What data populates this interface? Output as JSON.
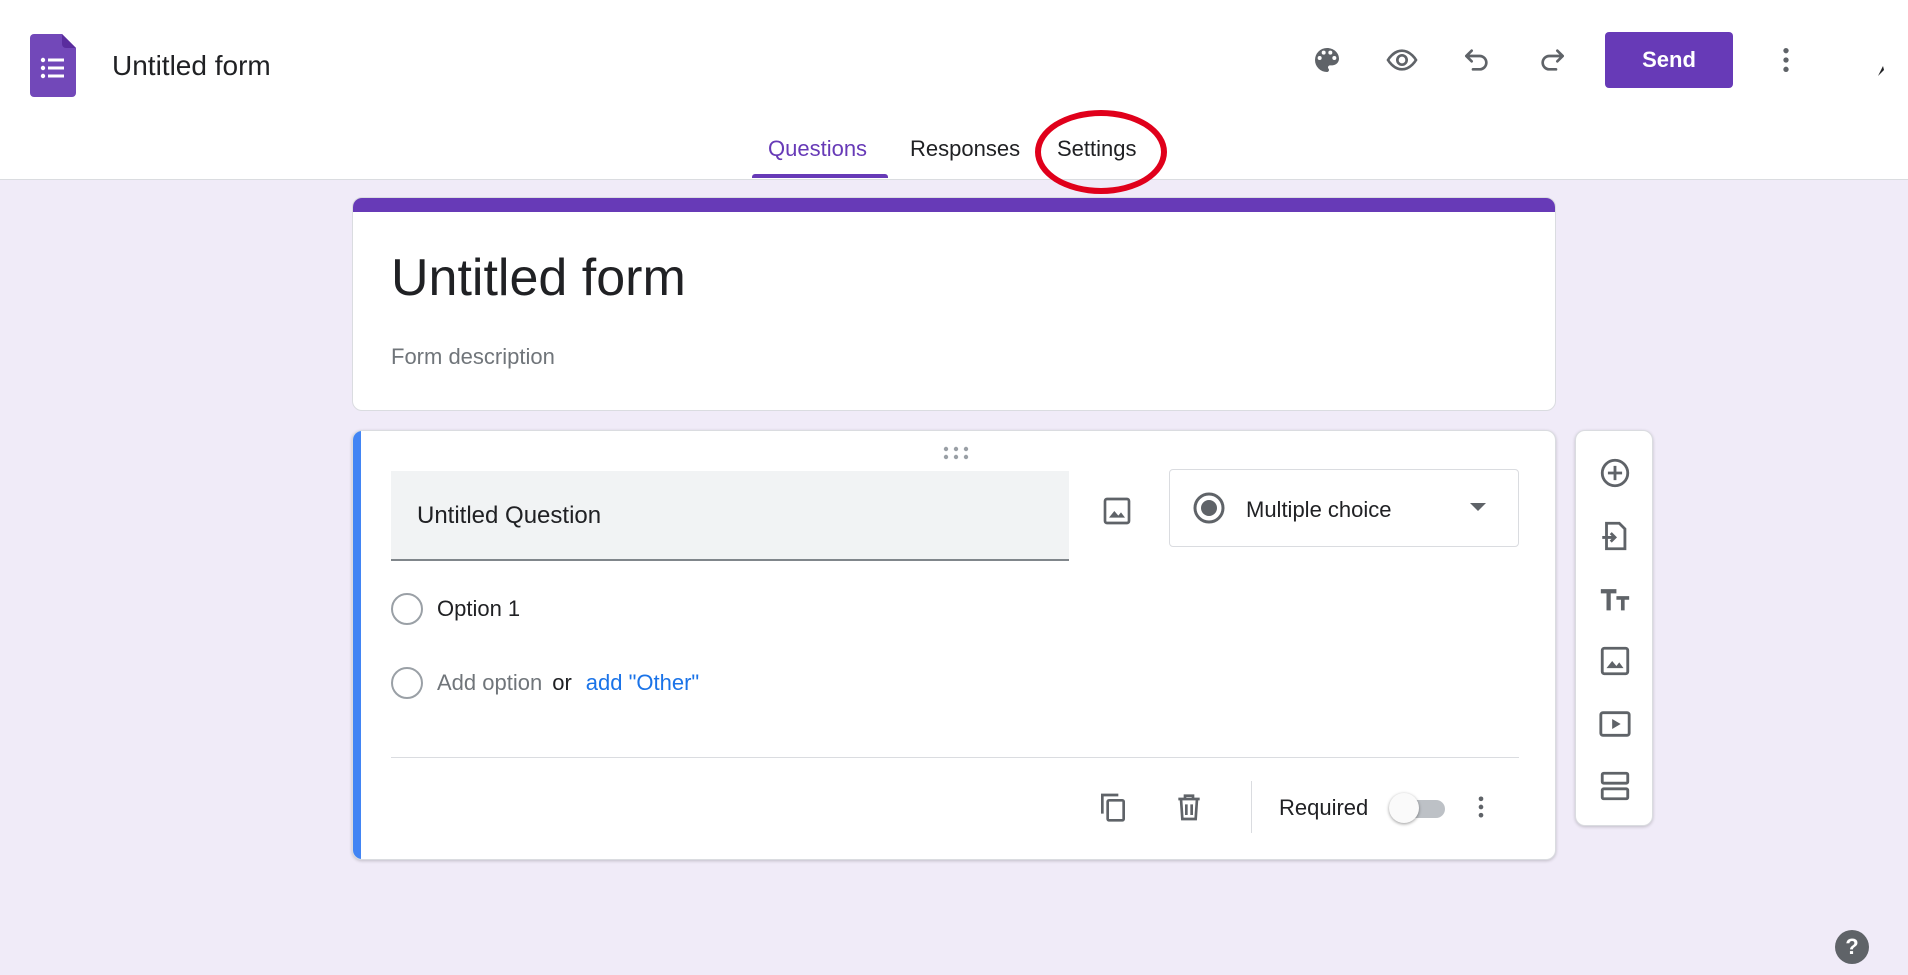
{
  "header": {
    "title": "Untitled form",
    "send_label": "Send",
    "icons": [
      "palette-icon",
      "eye-icon",
      "undo-icon",
      "redo-icon",
      "more-vert-icon"
    ]
  },
  "tabs": [
    {
      "label": "Questions",
      "active": true
    },
    {
      "label": "Responses",
      "active": false
    },
    {
      "label": "Settings",
      "active": false
    }
  ],
  "title_card": {
    "title": "Untitled form",
    "description_placeholder": "Form description"
  },
  "question": {
    "title": "Untitled Question",
    "type": "Multiple choice",
    "options": [
      "Option 1"
    ],
    "add_option": "Add option",
    "or": "or",
    "add_other": "add \"Other\"",
    "required_label": "Required",
    "required": false
  },
  "side_toolbar": [
    "add-question-icon",
    "import-questions-icon",
    "add-title-icon",
    "add-image-icon",
    "add-video-icon",
    "add-section-icon"
  ],
  "help": "?",
  "colors": {
    "accent": "#673ab7",
    "background": "#f0ebf8",
    "question_accent": "#4285f4",
    "link": "#1a73e8",
    "highlight": "#e0001b"
  }
}
